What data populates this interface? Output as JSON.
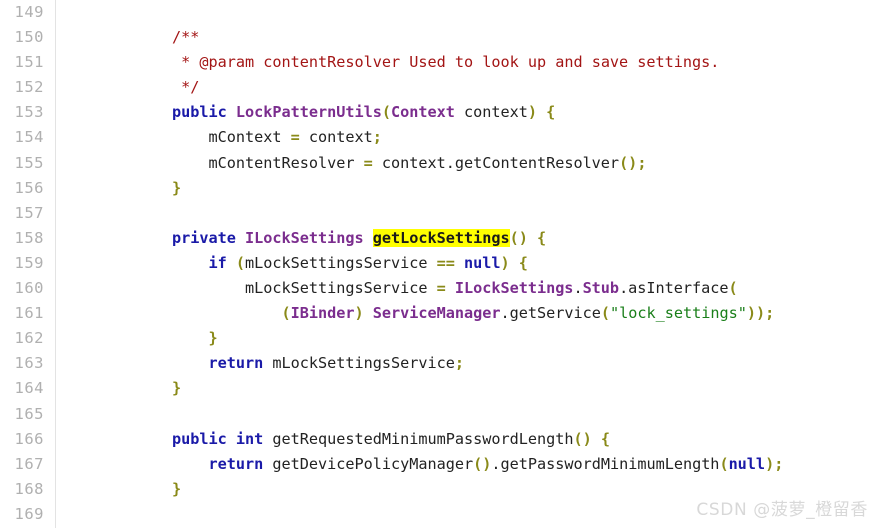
{
  "viewer": {
    "background_color": "#ffffff",
    "gutter_rule_color": "#e3e3e3",
    "first_line_number": 149,
    "last_line_number": 169,
    "language": "java"
  },
  "colors": {
    "keyword": "#1a1aa8",
    "type": "#7b2d8e",
    "comment": "#a31515",
    "string": "#1a7f1a",
    "punctuation": "#8a8a19",
    "plain": "#222222",
    "highlight_background": "#ffff00",
    "line_number": "#b0b0b0",
    "watermark": "#d8d8d8"
  },
  "watermark": {
    "text": "CSDN @菠萝_橙留香"
  },
  "code": {
    "lines": [
      {
        "number": "149",
        "tokens": []
      },
      {
        "number": "150",
        "tokens": [
          {
            "t": "        ",
            "c": "plain"
          },
          {
            "t": "/**",
            "c": "comment"
          }
        ]
      },
      {
        "number": "151",
        "tokens": [
          {
            "t": "         ",
            "c": "plain"
          },
          {
            "t": "* @param contentResolver Used to look up and save settings.",
            "c": "comment"
          }
        ]
      },
      {
        "number": "152",
        "tokens": [
          {
            "t": "         ",
            "c": "plain"
          },
          {
            "t": "*/",
            "c": "comment"
          }
        ]
      },
      {
        "number": "153",
        "tokens": [
          {
            "t": "        ",
            "c": "plain"
          },
          {
            "t": "public",
            "c": "keyword"
          },
          {
            "t": " ",
            "c": "plain"
          },
          {
            "t": "LockPatternUtils",
            "c": "type"
          },
          {
            "t": "(",
            "c": "punctuation"
          },
          {
            "t": "Context",
            "c": "type"
          },
          {
            "t": " context",
            "c": "plain"
          },
          {
            "t": ")",
            "c": "punctuation"
          },
          {
            "t": " ",
            "c": "plain"
          },
          {
            "t": "{",
            "c": "punctuation"
          }
        ]
      },
      {
        "number": "154",
        "tokens": [
          {
            "t": "            mContext ",
            "c": "plain"
          },
          {
            "t": "=",
            "c": "punctuation"
          },
          {
            "t": " context",
            "c": "plain"
          },
          {
            "t": ";",
            "c": "punctuation"
          }
        ]
      },
      {
        "number": "155",
        "tokens": [
          {
            "t": "            mContentResolver ",
            "c": "plain"
          },
          {
            "t": "=",
            "c": "punctuation"
          },
          {
            "t": " context.getContentResolver",
            "c": "plain"
          },
          {
            "t": "()",
            "c": "punctuation"
          },
          {
            "t": ";",
            "c": "punctuation"
          }
        ]
      },
      {
        "number": "156",
        "tokens": [
          {
            "t": "        ",
            "c": "plain"
          },
          {
            "t": "}",
            "c": "punctuation"
          }
        ]
      },
      {
        "number": "157",
        "tokens": []
      },
      {
        "number": "158",
        "tokens": [
          {
            "t": "        ",
            "c": "plain"
          },
          {
            "t": "private",
            "c": "keyword"
          },
          {
            "t": " ",
            "c": "plain"
          },
          {
            "t": "ILockSettings",
            "c": "type"
          },
          {
            "t": " ",
            "c": "plain"
          },
          {
            "t": "getLockSettings",
            "c": "highlight"
          },
          {
            "t": "()",
            "c": "punctuation"
          },
          {
            "t": " ",
            "c": "plain"
          },
          {
            "t": "{",
            "c": "punctuation"
          }
        ]
      },
      {
        "number": "159",
        "tokens": [
          {
            "t": "            ",
            "c": "plain"
          },
          {
            "t": "if",
            "c": "keyword"
          },
          {
            "t": " ",
            "c": "plain"
          },
          {
            "t": "(",
            "c": "punctuation"
          },
          {
            "t": "mLockSettingsService ",
            "c": "plain"
          },
          {
            "t": "==",
            "c": "punctuation"
          },
          {
            "t": " ",
            "c": "plain"
          },
          {
            "t": "null",
            "c": "keyword"
          },
          {
            "t": ")",
            "c": "punctuation"
          },
          {
            "t": " ",
            "c": "plain"
          },
          {
            "t": "{",
            "c": "punctuation"
          }
        ]
      },
      {
        "number": "160",
        "tokens": [
          {
            "t": "                mLockSettingsService ",
            "c": "plain"
          },
          {
            "t": "=",
            "c": "punctuation"
          },
          {
            "t": " ",
            "c": "plain"
          },
          {
            "t": "ILockSettings",
            "c": "type"
          },
          {
            "t": ".",
            "c": "plain"
          },
          {
            "t": "Stub",
            "c": "type"
          },
          {
            "t": ".asInterface",
            "c": "plain"
          },
          {
            "t": "(",
            "c": "punctuation"
          }
        ]
      },
      {
        "number": "161",
        "tokens": [
          {
            "t": "                    ",
            "c": "plain"
          },
          {
            "t": "(",
            "c": "punctuation"
          },
          {
            "t": "IBinder",
            "c": "type"
          },
          {
            "t": ")",
            "c": "punctuation"
          },
          {
            "t": " ",
            "c": "plain"
          },
          {
            "t": "ServiceManager",
            "c": "type"
          },
          {
            "t": ".getService",
            "c": "plain"
          },
          {
            "t": "(",
            "c": "punctuation"
          },
          {
            "t": "\"lock_settings\"",
            "c": "string"
          },
          {
            "t": "))",
            "c": "punctuation"
          },
          {
            "t": ";",
            "c": "punctuation"
          }
        ]
      },
      {
        "number": "162",
        "tokens": [
          {
            "t": "            ",
            "c": "plain"
          },
          {
            "t": "}",
            "c": "punctuation"
          }
        ]
      },
      {
        "number": "163",
        "tokens": [
          {
            "t": "            ",
            "c": "plain"
          },
          {
            "t": "return",
            "c": "keyword"
          },
          {
            "t": " mLockSettingsService",
            "c": "plain"
          },
          {
            "t": ";",
            "c": "punctuation"
          }
        ]
      },
      {
        "number": "164",
        "tokens": [
          {
            "t": "        ",
            "c": "plain"
          },
          {
            "t": "}",
            "c": "punctuation"
          }
        ]
      },
      {
        "number": "165",
        "tokens": []
      },
      {
        "number": "166",
        "tokens": [
          {
            "t": "        ",
            "c": "plain"
          },
          {
            "t": "public",
            "c": "keyword"
          },
          {
            "t": " ",
            "c": "plain"
          },
          {
            "t": "int",
            "c": "keyword"
          },
          {
            "t": " getRequestedMinimumPasswordLength",
            "c": "plain"
          },
          {
            "t": "()",
            "c": "punctuation"
          },
          {
            "t": " ",
            "c": "plain"
          },
          {
            "t": "{",
            "c": "punctuation"
          }
        ]
      },
      {
        "number": "167",
        "tokens": [
          {
            "t": "            ",
            "c": "plain"
          },
          {
            "t": "return",
            "c": "keyword"
          },
          {
            "t": " getDevicePolicyManager",
            "c": "plain"
          },
          {
            "t": "()",
            "c": "punctuation"
          },
          {
            "t": ".getPasswordMinimumLength",
            "c": "plain"
          },
          {
            "t": "(",
            "c": "punctuation"
          },
          {
            "t": "null",
            "c": "keyword"
          },
          {
            "t": ")",
            "c": "punctuation"
          },
          {
            "t": ";",
            "c": "punctuation"
          }
        ]
      },
      {
        "number": "168",
        "tokens": [
          {
            "t": "        ",
            "c": "plain"
          },
          {
            "t": "}",
            "c": "punctuation"
          }
        ]
      },
      {
        "number": "169",
        "tokens": []
      }
    ]
  }
}
